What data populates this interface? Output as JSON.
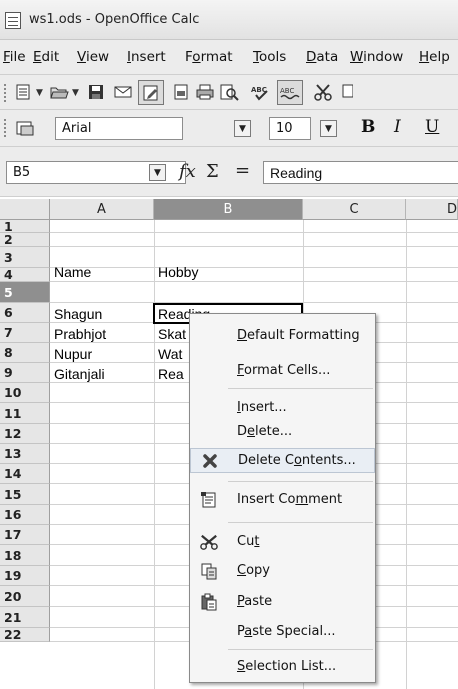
{
  "window": {
    "title": "ws1.ods - OpenOffice Calc"
  },
  "menubar": [
    {
      "pre": "",
      "ul": "F",
      "post": "ile"
    },
    {
      "pre": "",
      "ul": "E",
      "post": "dit"
    },
    {
      "pre": "",
      "ul": "V",
      "post": "iew"
    },
    {
      "pre": "",
      "ul": "I",
      "post": "nsert"
    },
    {
      "pre": "F",
      "ul": "o",
      "post": "rmat"
    },
    {
      "pre": "",
      "ul": "T",
      "post": "ools"
    },
    {
      "pre": "",
      "ul": "D",
      "post": "ata"
    },
    {
      "pre": "",
      "ul": "W",
      "post": "indow"
    },
    {
      "pre": "",
      "ul": "H",
      "post": "elp"
    }
  ],
  "format_toolbar": {
    "font_name": "Arial",
    "font_size": "10",
    "bold": "B",
    "italic": "I",
    "underline": "U"
  },
  "formula_bar": {
    "name_box": "B5",
    "function_wizard": "fx",
    "sum": "Σ",
    "equals": "=",
    "content": "Reading"
  },
  "sheet": {
    "columns": [
      "A",
      "B",
      "C",
      "D"
    ],
    "selected_column": "B",
    "rows": [
      "1",
      "2",
      "3",
      "4",
      "5",
      "6",
      "7",
      "8",
      "9",
      "10",
      "11",
      "12",
      "13",
      "14",
      "15",
      "16",
      "17",
      "18",
      "19",
      "20",
      "21",
      "22"
    ],
    "selected_row": "5",
    "cells": {
      "A3": "Name",
      "B3": "Hobby",
      "A5": "Shagun",
      "B5": "Reading",
      "A6": "Prabhjot",
      "B6": "Skat",
      "A7": "Nupur",
      "B7": "Wat",
      "A8": "Gitanjali",
      "B8": "Rea"
    }
  },
  "context_menu": [
    {
      "pre": "",
      "ul": "D",
      "post": "efault Formatting"
    },
    {
      "pre": "",
      "ul": "F",
      "post": "ormat Cells..."
    },
    {
      "pre": "",
      "ul": "I",
      "post": "nsert..."
    },
    {
      "pre": "D",
      "ul": "e",
      "post": "lete..."
    },
    {
      "pre": "Delete C",
      "ul": "o",
      "post": "ntents...",
      "icon": "delete-contents-icon"
    },
    {
      "pre": "Insert Co",
      "ul": "m",
      "post": "ment",
      "icon": "insert-comment-icon"
    },
    {
      "pre": "Cu",
      "ul": "t",
      "post": "",
      "icon": "cut-icon"
    },
    {
      "pre": "",
      "ul": "C",
      "post": "opy",
      "icon": "copy-icon"
    },
    {
      "pre": "",
      "ul": "P",
      "post": "aste",
      "icon": "paste-icon"
    },
    {
      "pre": "P",
      "ul": "a",
      "post": "ste Special..."
    },
    {
      "pre": "",
      "ul": "S",
      "post": "election List..."
    }
  ]
}
